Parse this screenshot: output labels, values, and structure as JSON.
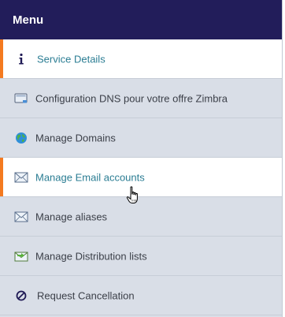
{
  "menu": {
    "title": "Menu",
    "items": [
      {
        "label": "Service Details",
        "icon": "info-icon",
        "active": true
      },
      {
        "label": "Configuration DNS pour votre offre Zimbra",
        "icon": "monitor-icon",
        "active": false
      },
      {
        "label": "Manage Domains",
        "icon": "globe-icon",
        "active": false
      },
      {
        "label": "Manage Email accounts",
        "icon": "envelope-icon",
        "active": true
      },
      {
        "label": "Manage aliases",
        "icon": "envelope-icon",
        "active": false
      },
      {
        "label": "Manage Distribution lists",
        "icon": "envelope-arrow-icon",
        "active": false
      },
      {
        "label": "Request Cancellation",
        "icon": "ban-icon",
        "active": false
      }
    ]
  },
  "colors": {
    "header_bg": "#221d5a",
    "item_bg": "#d9dee7",
    "active_bg": "#ffffff",
    "active_text": "#2b7d93",
    "accent": "#f47a20"
  }
}
